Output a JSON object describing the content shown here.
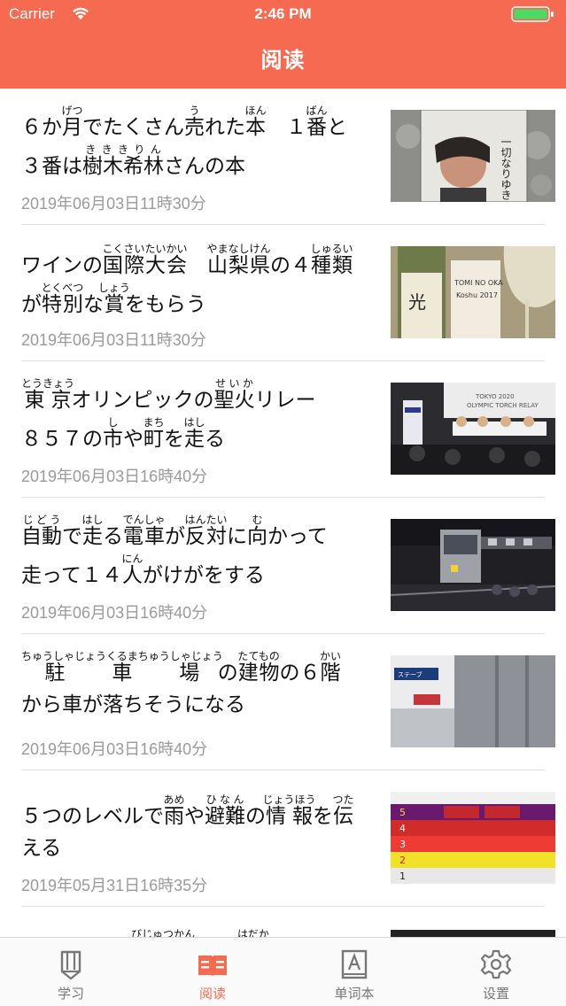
{
  "status": {
    "carrier": "Carrier",
    "time": "2:46 PM"
  },
  "header": {
    "title": "阅读",
    "color": "#f56a50"
  },
  "articles": [
    {
      "date": "2019年06月03日11時30分",
      "thumb_icon": "book-cover-photo"
    },
    {
      "date": "2019年06月03日11時30分",
      "thumb_icon": "wine-bottle-photo"
    },
    {
      "date": "2019年06月03日16時40分",
      "thumb_icon": "olympic-torch-relay-photo"
    },
    {
      "date": "2019年06月03日16時40分",
      "thumb_icon": "train-accident-photo"
    },
    {
      "date": "2019年06月03日16時40分",
      "thumb_icon": "car-on-building-photo"
    },
    {
      "date": "2019年05月31日16時35分",
      "thumb_icon": "warning-level-table-photo"
    }
  ],
  "tabs": [
    {
      "label": "学习",
      "icon": "pencil-icon",
      "active": false
    },
    {
      "label": "阅读",
      "icon": "open-book-icon",
      "active": true
    },
    {
      "label": "单词本",
      "icon": "dictionary-icon",
      "active": false
    },
    {
      "label": "设置",
      "icon": "gear-icon",
      "active": false
    }
  ],
  "partial_next_item_furigana": {
    "a": "びじゅつかん",
    "b": "はだか"
  }
}
